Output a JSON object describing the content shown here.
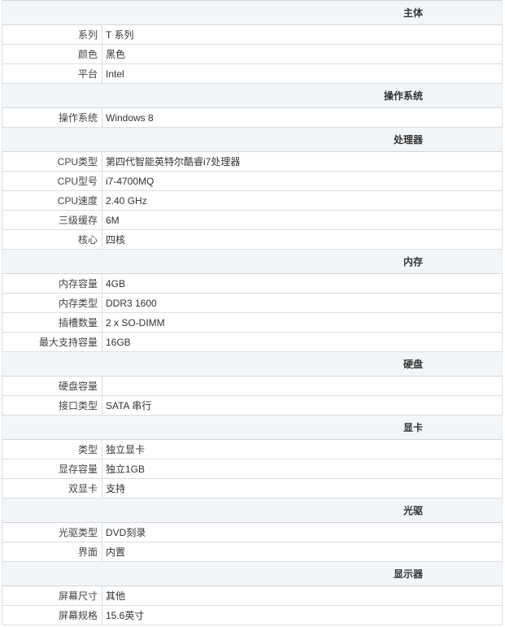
{
  "sections": [
    {
      "title": "主体",
      "rows": [
        {
          "key": "系列",
          "value": "T 系列"
        },
        {
          "key": "颜色",
          "value": "黑色"
        },
        {
          "key": "平台",
          "value": "Intel"
        }
      ]
    },
    {
      "title": "操作系统",
      "rows": [
        {
          "key": "操作系统",
          "value": "Windows 8"
        }
      ]
    },
    {
      "title": "处理器",
      "rows": [
        {
          "key": "CPU类型",
          "value": "第四代智能英特尔酷睿i7处理器"
        },
        {
          "key": "CPU型号",
          "value": "i7-4700MQ"
        },
        {
          "key": "CPU速度",
          "value": "2.40 GHz"
        },
        {
          "key": "三级缓存",
          "value": "6M"
        },
        {
          "key": "核心",
          "value": "四核"
        }
      ]
    },
    {
      "title": "内存",
      "rows": [
        {
          "key": "内存容量",
          "value": "4GB"
        },
        {
          "key": "内存类型",
          "value": "DDR3 1600"
        },
        {
          "key": "插槽数量",
          "value": "2 x SO-DIMM"
        },
        {
          "key": "最大支持容量",
          "value": "16GB"
        }
      ]
    },
    {
      "title": "硬盘",
      "rows": [
        {
          "key": "硬盘容量",
          "value": ""
        },
        {
          "key": "接口类型",
          "value": "SATA 串行"
        }
      ]
    },
    {
      "title": "显卡",
      "rows": [
        {
          "key": "类型",
          "value": "独立显卡"
        },
        {
          "key": "显存容量",
          "value": "独立1GB"
        },
        {
          "key": "双显卡",
          "value": "支持"
        }
      ]
    },
    {
      "title": "光驱",
      "rows": [
        {
          "key": "光驱类型",
          "value": "DVD刻录"
        },
        {
          "key": "界面",
          "value": "内置"
        }
      ]
    },
    {
      "title": "显示器",
      "rows": [
        {
          "key": "屏幕尺寸",
          "value": "其他"
        },
        {
          "key": "屏幕规格",
          "value": "15.6英寸"
        }
      ]
    }
  ]
}
